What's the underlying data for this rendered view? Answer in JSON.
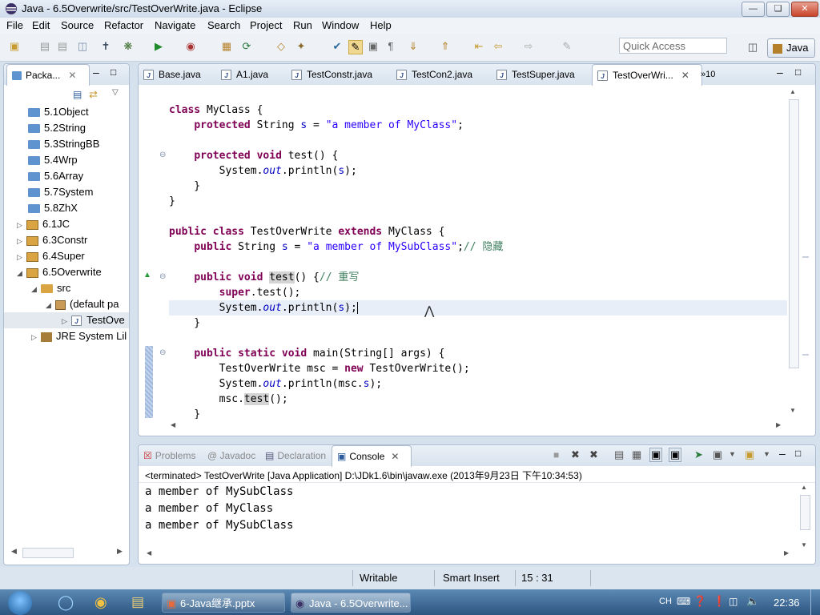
{
  "window": {
    "title": "Java - 6.5Overwrite/src/TestOverWrite.java - Eclipse"
  },
  "menu": [
    "File",
    "Edit",
    "Source",
    "Refactor",
    "Navigate",
    "Search",
    "Project",
    "Run",
    "Window",
    "Help"
  ],
  "toolbar": {
    "quick_access_placeholder": "Quick Access",
    "perspective": "Java"
  },
  "package_explorer": {
    "tab_label": "Packa...",
    "items": [
      {
        "label": "5.1Object"
      },
      {
        "label": "5.2String"
      },
      {
        "label": "5.3StringBB"
      },
      {
        "label": "5.4Wrp"
      },
      {
        "label": "5.6Array"
      },
      {
        "label": "5.7System"
      },
      {
        "label": "5.8ZhX"
      },
      {
        "label": "6.1JC"
      },
      {
        "label": "6.3Constr"
      },
      {
        "label": "6.4Super"
      },
      {
        "label": "6.5Overwrite"
      },
      {
        "label": "src"
      },
      {
        "label": "(default pa"
      },
      {
        "label": "TestOve"
      },
      {
        "label": "JRE System Lil"
      }
    ]
  },
  "editor": {
    "tabs": [
      "Base.java",
      "A1.java",
      "TestConstr.java",
      "TestCon2.java",
      "TestSuper.java",
      "TestOverWri..."
    ],
    "overflow": "»10"
  },
  "bottom_panel": {
    "tabs": [
      "Problems",
      "@ Javadoc",
      "Declaration",
      "Console"
    ],
    "console_header": "<terminated> TestOverWrite [Java Application] D:\\JDk1.6\\bin\\javaw.exe (2013年9月23日 下午10:34:53)",
    "output": [
      "a member of MySubClass",
      "a member of MyClass",
      "a member of MySubClass"
    ]
  },
  "status": {
    "writable": "Writable",
    "insert_mode": "Smart Insert",
    "position": "15 : 31"
  },
  "taskbar": {
    "items": [
      "6-Java继承.pptx",
      "Java - 6.5Overwrite..."
    ],
    "lang": "CH",
    "clock": "22:36"
  }
}
